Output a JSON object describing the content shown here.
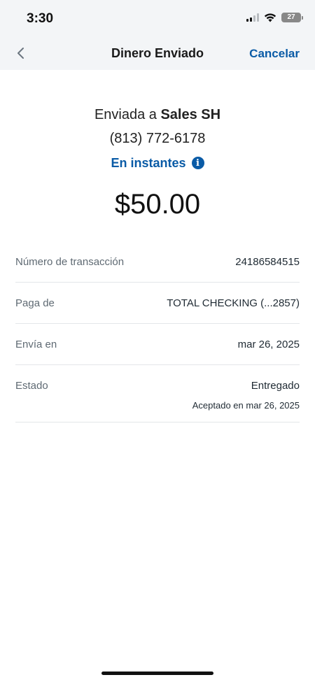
{
  "status_bar": {
    "time": "3:30",
    "battery_level": "27",
    "icons": [
      "signal-icon",
      "wifi-icon",
      "battery-icon"
    ]
  },
  "header": {
    "title": "Dinero Enviado",
    "back_icon": "chevron-left-icon",
    "cancel_label": "Cancelar"
  },
  "summary": {
    "sent_prefix": "Enviada a ",
    "recipient": "Sales SH",
    "phone": "(813) 772-6178",
    "speed_label": "En instantes",
    "info_icon": "info-icon",
    "amount": "$50.00"
  },
  "details": [
    {
      "label": "Número de transacción",
      "value": "24186584515"
    },
    {
      "label": "Paga de",
      "value": "TOTAL CHECKING (...2857)"
    },
    {
      "label": "Envía en",
      "value": "mar 26, 2025"
    },
    {
      "label": "Estado",
      "value": "Entregado",
      "sub": "Aceptado en mar 26, 2025"
    }
  ],
  "colors": {
    "accent": "#0a5ba6",
    "header_bg": "#f3f5f7",
    "divider": "#e3e6e9"
  }
}
